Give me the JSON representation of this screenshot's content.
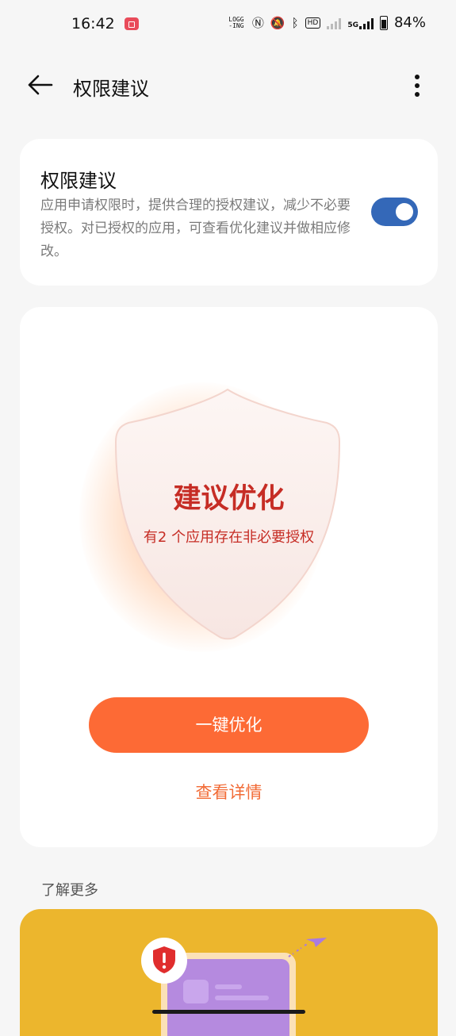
{
  "status_bar": {
    "time": "16:42",
    "logging_line1": "LOGG",
    "logging_line2": "-ING",
    "battery": "84%",
    "network": "5G",
    "icons": [
      "screen-record-icon",
      "nfc-icon",
      "mute-icon",
      "bluetooth-icon",
      "hd-icon",
      "signal-icon",
      "battery-icon"
    ]
  },
  "app_bar": {
    "title": "权限建议"
  },
  "permission_card": {
    "title": "权限建议",
    "description": "应用申请权限时，提供合理的授权建议，减少不必要授权。对已授权的应用，可查看优化建议并做相应修改。",
    "toggle_on": true
  },
  "status_card": {
    "status_title": "建议优化",
    "status_subtitle": "有2 个应用存在非必要授权",
    "optimize_button": "一键优化",
    "details_link": "查看详情"
  },
  "learn_more": {
    "label": "了解更多"
  },
  "colors": {
    "toggle": "#3468b8",
    "accent_orange": "#fd6a35",
    "status_red": "#c62d25",
    "banner_yellow": "#ecb62d"
  }
}
